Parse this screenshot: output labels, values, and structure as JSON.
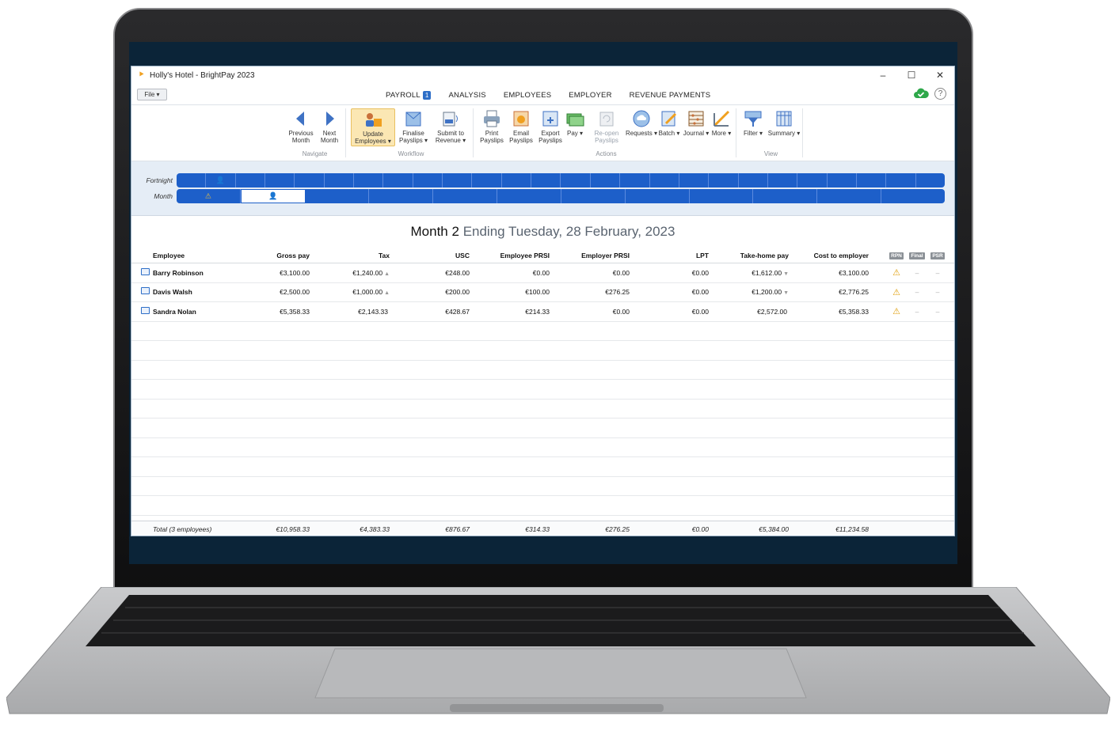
{
  "window": {
    "title": "Holly's Hotel - BrightPay 2023"
  },
  "controls": {
    "minimize": "–",
    "maximize": "☐",
    "close": "✕"
  },
  "file_menu": "File ▾",
  "tabs": [
    {
      "label": "PAYROLL",
      "badge": "1",
      "active": true
    },
    {
      "label": "ANALYSIS"
    },
    {
      "label": "EMPLOYEES"
    },
    {
      "label": "EMPLOYER"
    },
    {
      "label": "REVENUE PAYMENTS"
    }
  ],
  "ribbon": {
    "navigate": {
      "label": "Navigate",
      "previous": "Previous Month",
      "next": "Next Month"
    },
    "workflow": {
      "label": "Workflow",
      "update": "Update Employees ▾",
      "finalise": "Finalise Payslips ▾",
      "submit": "Submit to Revenue ▾"
    },
    "actions": {
      "label": "Actions",
      "print": "Print Payslips",
      "email": "Email Payslips",
      "export": "Export Payslips",
      "pay": "Pay ▾",
      "reopen": "Re-open Payslips",
      "requests": "Requests ▾",
      "batch": "Batch ▾",
      "journal": "Journal ▾",
      "more": "More ▾"
    },
    "view": {
      "label": "View",
      "filter": "Filter ▾",
      "summary": "Summary ▾"
    }
  },
  "periods": {
    "fortnight_label": "Fortnight",
    "month_label": "Month"
  },
  "heading": {
    "main": "Month 2",
    "sub": "Ending Tuesday, 28 February, 2023"
  },
  "columns": {
    "employee": "Employee",
    "gross": "Gross pay",
    "tax": "Tax",
    "usc": "USC",
    "eprsi": "Employee PRSI",
    "erprsi": "Employer PRSI",
    "lpt": "LPT",
    "takehome": "Take-home pay",
    "cost": "Cost to employer",
    "rpn": "RPN",
    "final": "Final",
    "psr": "PSR"
  },
  "rows": [
    {
      "name": "Barry Robinson",
      "gross": "€3,100.00",
      "tax": "€1,240.00",
      "tax_arrow": "▲",
      "usc": "€248.00",
      "eprsi": "€0.00",
      "erprsi": "€0.00",
      "lpt": "€0.00",
      "takehome": "€1,612.00",
      "takehome_arrow": "▼",
      "cost": "€3,100.00",
      "final": "–",
      "psr": "–"
    },
    {
      "name": "Davis Walsh",
      "gross": "€2,500.00",
      "tax": "€1,000.00",
      "tax_arrow": "▲",
      "usc": "€200.00",
      "eprsi": "€100.00",
      "erprsi": "€276.25",
      "lpt": "€0.00",
      "takehome": "€1,200.00",
      "takehome_arrow": "▼",
      "cost": "€2,776.25",
      "final": "–",
      "psr": "–"
    },
    {
      "name": "Sandra Nolan",
      "gross": "€5,358.33",
      "tax": "€2,143.33",
      "tax_arrow": "",
      "usc": "€428.67",
      "eprsi": "€214.33",
      "erprsi": "€0.00",
      "lpt": "€0.00",
      "takehome": "€2,572.00",
      "takehome_arrow": "",
      "cost": "€5,358.33",
      "final": "–",
      "psr": "–"
    }
  ],
  "totals": {
    "label": "Total (3 employees)",
    "gross": "€10,958.33",
    "tax": "€4,383.33",
    "usc": "€876.67",
    "eprsi": "€314.33",
    "erprsi": "€276.25",
    "lpt": "€0.00",
    "takehome": "€5,384.00",
    "cost": "€11,234.58"
  },
  "help": "?"
}
